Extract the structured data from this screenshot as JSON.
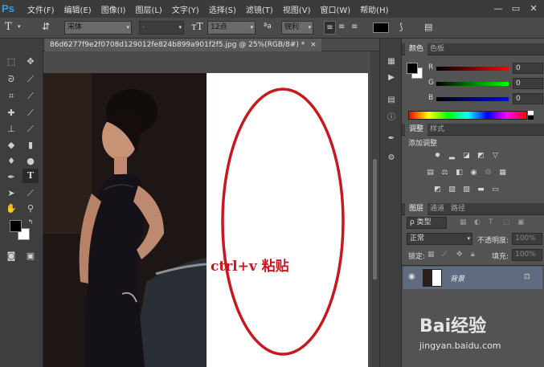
{
  "app": {
    "logo": "Ps"
  },
  "menu": [
    "文件(F)",
    "编辑(E)",
    "图像(I)",
    "图层(L)",
    "文字(Y)",
    "选择(S)",
    "滤镜(T)",
    "视图(V)",
    "窗口(W)",
    "帮助(H)"
  ],
  "window_controls": {
    "minimize": "—",
    "restore": "▭",
    "close": "✕"
  },
  "options": {
    "font_family": "宋体",
    "font_style": "-",
    "font_size": "12点",
    "aa_label": "ªa",
    "antialias": "锐利"
  },
  "document": {
    "tab_title": "86d6277f9e2f0708d129012fe824b899a901f2f5.jpg @ 25%(RGB/8#) *",
    "tab_close": "×",
    "overlay_text": "ctrl+v 粘贴"
  },
  "color_panel": {
    "tabs": [
      "颜色",
      "色板"
    ],
    "channels": [
      {
        "label": "R",
        "value": "0"
      },
      {
        "label": "G",
        "value": "0"
      },
      {
        "label": "B",
        "value": "0"
      }
    ]
  },
  "adjust_panel": {
    "tabs": [
      "调整",
      "样式"
    ],
    "title": "添加调整"
  },
  "layers_panel": {
    "tabs": [
      "图层",
      "通道",
      "路径"
    ],
    "filter": "ρ 类型",
    "blend_mode": "正常",
    "opacity_label": "不透明度:",
    "opacity_value": "100%",
    "lock_label": "锁定:",
    "fill_label": "填充:",
    "fill_value": "100%",
    "layer_name": "背景"
  },
  "watermark": {
    "brand": "Bai经验",
    "url": "jingyan.baidu.com"
  },
  "colors": {
    "accent_blue": "#3a9bdc",
    "ellipse_red": "#c8171e",
    "layer_selected": "#5f6b80"
  }
}
